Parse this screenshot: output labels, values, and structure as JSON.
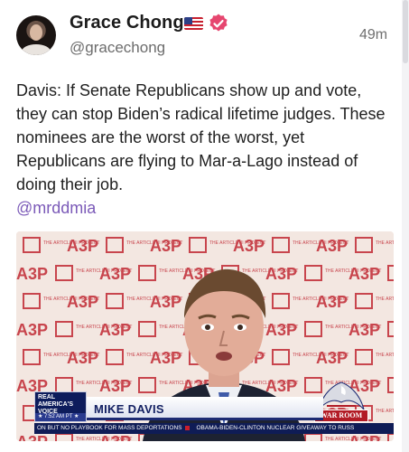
{
  "post": {
    "author": {
      "name": "Grace Chong",
      "handle": "@gracechong",
      "flag_icon": "us-flag-icon",
      "verified_icon": "verified-badge-icon",
      "verified_color": "#e6466f"
    },
    "timestamp": "49m",
    "text": "Davis: If Senate Republicans show up and vote, they can stop Biden’s radical lifetime judges. These nominees are the worst of the worst, yet Republicans are flying to Mar-a-Lago instead of doing their job.",
    "mention": "@mrddmia",
    "mention_color": "#7b5ab8"
  },
  "video": {
    "backdrop_logo": "A3P",
    "backdrop_small_text": "THE ARTICLE III PROJECT",
    "channel_logo": "REAL AMERICA'S VOICE",
    "time": "★ 7:52 AM PT ★",
    "name_bar": "MIKE DAVIS",
    "show_badge": "WAR ROOM",
    "ticker": [
      "ON BUT NO PLAYBOOK FOR MASS DEPORTATIONS",
      "OBAMA-BIDEN-CLINTON NUCLEAR GIVEAWAY TO RUSS"
    ]
  }
}
